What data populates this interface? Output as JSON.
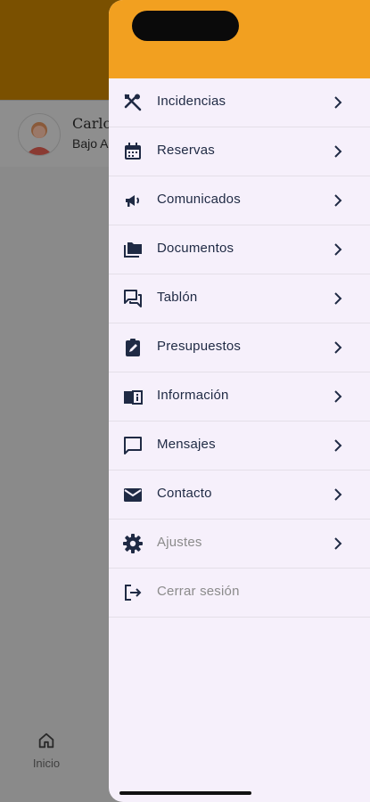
{
  "background": {
    "user": {
      "name": "Carlo",
      "subtitle": "Bajo A"
    },
    "bottom_nav": {
      "home_label": "Inicio"
    }
  },
  "drawer": {
    "items": [
      {
        "label": "Incidencias",
        "icon": "tools-icon"
      },
      {
        "label": "Reservas",
        "icon": "calendar-icon"
      },
      {
        "label": "Comunicados",
        "icon": "megaphone-icon"
      },
      {
        "label": "Documentos",
        "icon": "folder-icon"
      },
      {
        "label": "Tablón",
        "icon": "forum-icon"
      },
      {
        "label": "Presupuestos",
        "icon": "clipboard-edit-icon"
      },
      {
        "label": "Información",
        "icon": "info-book-icon"
      },
      {
        "label": "Mensajes",
        "icon": "chat-bubble-icon"
      },
      {
        "label": "Contacto",
        "icon": "mail-icon"
      },
      {
        "label": "Ajustes",
        "icon": "gear-icon"
      },
      {
        "label": "Cerrar sesión",
        "icon": "logout-icon"
      }
    ]
  },
  "colors": {
    "drawer_header": "#f2a020",
    "drawer_bg": "#f6f0fb",
    "text": "#1f2a44",
    "muted_text": "#8b8b8b"
  }
}
